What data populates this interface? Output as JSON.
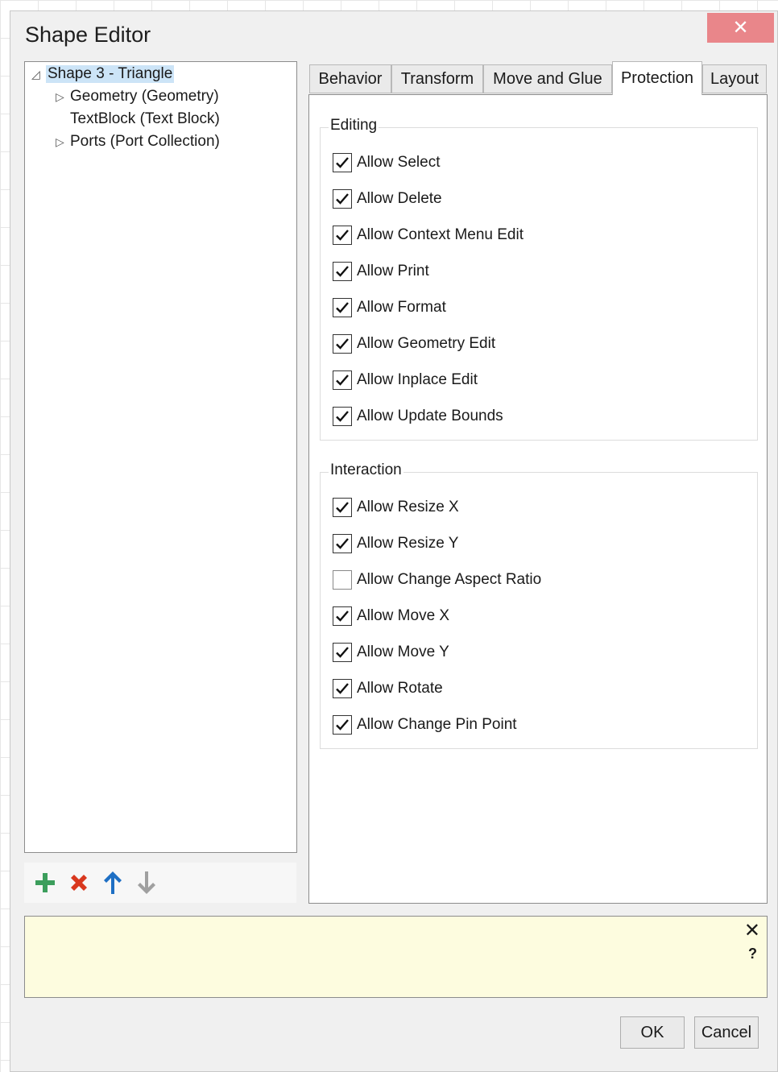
{
  "window": {
    "title": "Shape Editor",
    "close_glyph": "✕"
  },
  "tree": {
    "items": [
      {
        "label": "Shape 3 - Triangle",
        "arrow": "◿"
      },
      {
        "label": "Geometry (Geometry)",
        "arrow": "▷"
      },
      {
        "label": "TextBlock (Text Block)",
        "arrow": ""
      },
      {
        "label": "Ports (Port Collection)",
        "arrow": "▷"
      }
    ]
  },
  "toolbar": {
    "add_icon": "plus-icon",
    "delete_icon": "x-icon",
    "up_icon": "arrow-up-icon",
    "down_icon": "arrow-down-icon",
    "add_color": "#3c9e5c",
    "delete_color": "#d9381e",
    "up_color": "#1e6fc4",
    "down_color": "#a0a0a0"
  },
  "tabs": [
    {
      "label": "Behavior"
    },
    {
      "label": "Transform"
    },
    {
      "label": "Move and Glue"
    },
    {
      "label": "Protection"
    },
    {
      "label": "Layout"
    }
  ],
  "active_tab": "Protection",
  "editing": {
    "title": "Editing",
    "items": [
      {
        "label": "Allow Select",
        "checked": true
      },
      {
        "label": "Allow Delete",
        "checked": true
      },
      {
        "label": "Allow Context Menu Edit",
        "checked": true
      },
      {
        "label": "Allow Print",
        "checked": true
      },
      {
        "label": "Allow Format",
        "checked": true
      },
      {
        "label": "Allow Geometry Edit",
        "checked": true
      },
      {
        "label": "Allow Inplace Edit",
        "checked": true
      },
      {
        "label": "Allow Update Bounds",
        "checked": true
      }
    ]
  },
  "interaction": {
    "title": "Interaction",
    "items": [
      {
        "label": "Allow Resize X",
        "checked": true
      },
      {
        "label": "Allow Resize Y",
        "checked": true
      },
      {
        "label": "Allow Change Aspect Ratio",
        "checked": false
      },
      {
        "label": "Allow Move X",
        "checked": true
      },
      {
        "label": "Allow Move Y",
        "checked": true
      },
      {
        "label": "Allow Rotate",
        "checked": true
      },
      {
        "label": "Allow Change Pin Point",
        "checked": true
      }
    ]
  },
  "info_bar": {
    "close_glyph": "✕",
    "help_glyph": "?"
  },
  "buttons": {
    "ok": "OK",
    "cancel": "Cancel"
  },
  "colors": {
    "close_button": "#e9868a",
    "selection": "#cce4f7",
    "info_bar": "#fdfcdf"
  }
}
